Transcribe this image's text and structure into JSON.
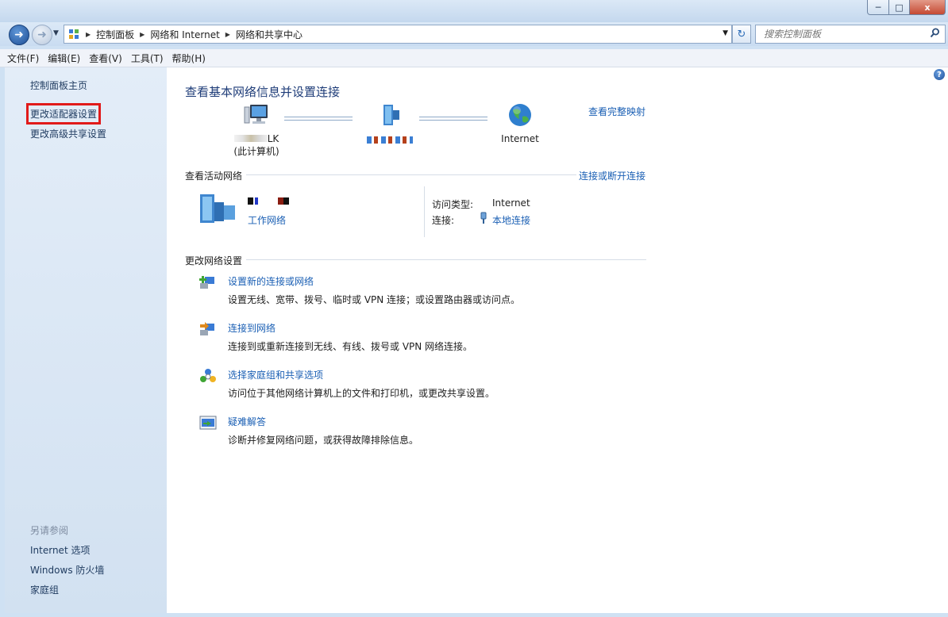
{
  "window": {
    "controls": [
      "minimize",
      "maximize",
      "close"
    ],
    "close_glyph": "x"
  },
  "address_bar": {
    "breadcrumbs": [
      "控制面板",
      "网络和 Internet",
      "网络和共享中心"
    ],
    "search_placeholder": "搜索控制面板"
  },
  "menu": [
    "文件(F)",
    "编辑(E)",
    "查看(V)",
    "工具(T)",
    "帮助(H)"
  ],
  "sidebar": {
    "links": [
      "控制面板主页",
      "更改适配器设置",
      "更改高级共享设置"
    ],
    "see_also_heading": "另请参阅",
    "see_also": [
      "Internet 选项",
      "Windows 防火墙",
      "家庭组"
    ]
  },
  "main": {
    "title": "查看基本网络信息并设置连接",
    "view_full_map": "查看完整映射",
    "network_map": {
      "this_computer_name_suffix": "LK",
      "this_computer_caption": "(此计算机)",
      "internet_label": "Internet"
    },
    "active_networks": {
      "heading": "查看活动网络",
      "connect_disconnect": "连接或断开连接",
      "network_type": "工作网络",
      "access_type_label": "访问类型:",
      "access_type_value": "Internet",
      "connections_label": "连接:",
      "connections_value": "本地连接"
    },
    "change_settings": {
      "heading": "更改网络设置",
      "tasks": [
        {
          "title": "设置新的连接或网络",
          "desc": "设置无线、宽带、拨号、临时或 VPN 连接；或设置路由器或访问点。"
        },
        {
          "title": "连接到网络",
          "desc": "连接到或重新连接到无线、有线、拨号或 VPN 网络连接。"
        },
        {
          "title": "选择家庭组和共享选项",
          "desc": "访问位于其他网络计算机上的文件和打印机，或更改共享设置。"
        },
        {
          "title": "疑难解答",
          "desc": "诊断并修复网络问题，或获得故障排除信息。"
        }
      ]
    }
  },
  "colors": {
    "link": "#1a5fb4",
    "title": "#1e3c78",
    "sidebar_bg": "#dce8f5",
    "highlight_box": "#e11a1a"
  }
}
